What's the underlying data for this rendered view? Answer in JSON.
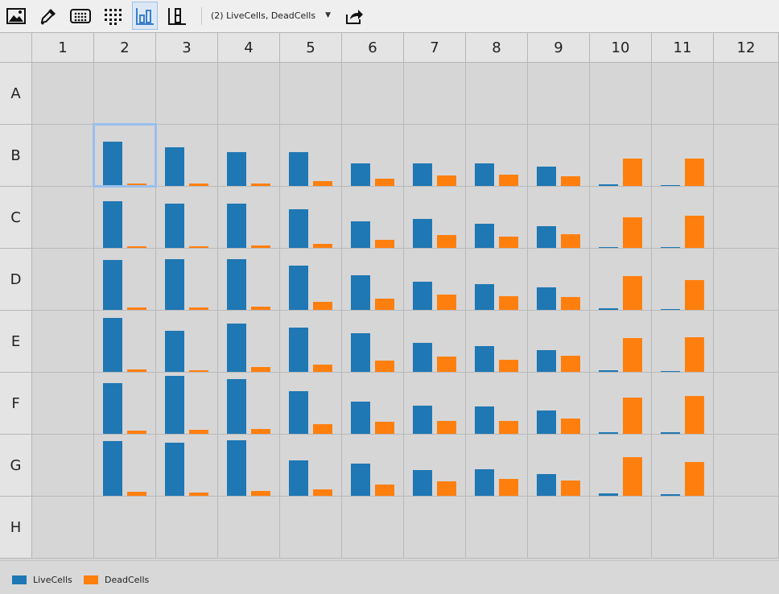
{
  "toolbar": {
    "buttons": [
      {
        "icon": "image-icon"
      },
      {
        "icon": "dropper-icon"
      },
      {
        "icon": "plate-icon"
      },
      {
        "icon": "dot-grid-icon"
      },
      {
        "icon": "bar-chart-icon",
        "active": true
      },
      {
        "icon": "column-chart-icon"
      }
    ],
    "selector_label": "(2) LiveCells, DeadCells",
    "export_icon": "export-icon"
  },
  "plate": {
    "columns": [
      "1",
      "2",
      "3",
      "4",
      "5",
      "6",
      "7",
      "8",
      "9",
      "10",
      "11",
      "12"
    ],
    "rows": [
      "A",
      "B",
      "C",
      "D",
      "E",
      "F",
      "G",
      "H"
    ],
    "selected_well": "B2",
    "max_value": 1.0
  },
  "series_colors": {
    "LiveCells": "#1f77b4",
    "DeadCells": "#ff7f0e"
  },
  "legend": [
    {
      "label": "LiveCells",
      "color": "#1f77b4"
    },
    {
      "label": "DeadCells",
      "color": "#ff7f0e"
    }
  ],
  "chart_data": {
    "type": "bar",
    "series": [
      {
        "name": "LiveCells",
        "values": {
          "B": [
            null,
            0.77,
            0.66,
            0.59,
            0.59,
            0.39,
            0.39,
            0.39,
            0.34,
            0.03,
            0.0,
            null
          ],
          "C": [
            null,
            0.81,
            0.76,
            0.76,
            0.66,
            0.46,
            0.5,
            0.42,
            0.37,
            0.01,
            0.0,
            null
          ],
          "D": [
            null,
            0.86,
            0.88,
            0.88,
            0.76,
            0.6,
            0.48,
            0.44,
            0.39,
            0.03,
            0.01,
            null
          ],
          "E": [
            null,
            0.93,
            0.71,
            0.84,
            0.76,
            0.67,
            0.5,
            0.45,
            0.38,
            0.03,
            0.01,
            null
          ],
          "F": [
            null,
            0.88,
            1.0,
            0.94,
            0.73,
            0.55,
            0.49,
            0.47,
            0.4,
            0.03,
            0.03,
            null
          ],
          "G": [
            null,
            0.95,
            0.92,
            0.96,
            0.61,
            0.56,
            0.44,
            0.46,
            0.38,
            0.04,
            0.03,
            null
          ]
        }
      },
      {
        "name": "DeadCells",
        "values": {
          "B": [
            null,
            0.04,
            0.04,
            0.04,
            0.08,
            0.12,
            0.18,
            0.19,
            0.16,
            0.47,
            0.47,
            null
          ],
          "C": [
            null,
            0.03,
            0.03,
            0.04,
            0.07,
            0.14,
            0.22,
            0.19,
            0.23,
            0.53,
            0.55,
            null
          ],
          "D": [
            null,
            0.04,
            0.04,
            0.05,
            0.14,
            0.2,
            0.27,
            0.23,
            0.22,
            0.59,
            0.52,
            null
          ],
          "E": [
            null,
            0.04,
            0.03,
            0.09,
            0.13,
            0.2,
            0.26,
            0.21,
            0.28,
            0.59,
            0.6,
            null
          ],
          "F": [
            null,
            0.05,
            0.07,
            0.08,
            0.16,
            0.21,
            0.22,
            0.22,
            0.26,
            0.62,
            0.65,
            null
          ],
          "G": [
            null,
            0.07,
            0.06,
            0.08,
            0.11,
            0.2,
            0.25,
            0.29,
            0.26,
            0.66,
            0.58,
            null
          ]
        }
      }
    ]
  }
}
